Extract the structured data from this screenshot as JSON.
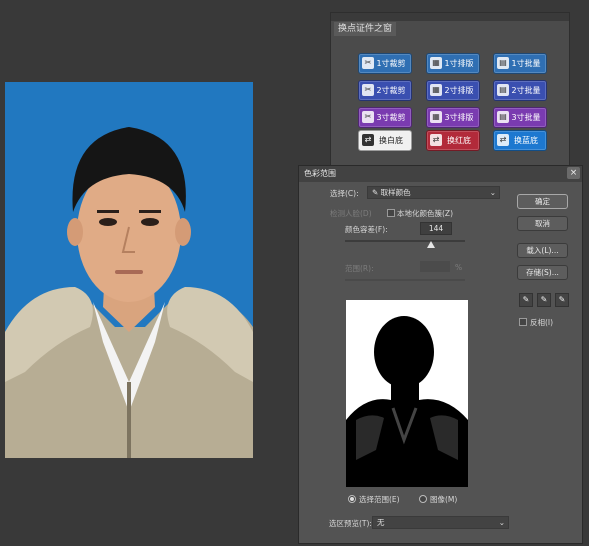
{
  "plugin": {
    "tab_label": "换点证件之窗",
    "buttons": [
      {
        "label": "1寸裁剪",
        "color": "#2f6fb3",
        "icon": "scissors-icon"
      },
      {
        "label": "1寸排版",
        "color": "#2f6fb3",
        "icon": "layout-icon"
      },
      {
        "label": "1寸批量",
        "color": "#2f6fb3",
        "icon": "batch-icon"
      },
      {
        "label": "2寸裁剪",
        "color": "#3a4fb0",
        "icon": "scissors-icon"
      },
      {
        "label": "2寸排版",
        "color": "#3a4fb0",
        "icon": "layout-icon"
      },
      {
        "label": "2寸批量",
        "color": "#3a4fb0",
        "icon": "batch-icon"
      },
      {
        "label": "3寸裁剪",
        "color": "#7a3bb0",
        "icon": "scissors-icon"
      },
      {
        "label": "3寸排版",
        "color": "#7a3bb0",
        "icon": "layout-icon"
      },
      {
        "label": "3寸批量",
        "color": "#7a3bb0",
        "icon": "batch-icon"
      },
      {
        "label": "换白底",
        "color": "#f0f0f0",
        "icon": "swap-icon"
      },
      {
        "label": "换红底",
        "color": "#b22a3a",
        "icon": "swap-icon"
      },
      {
        "label": "换蓝底",
        "color": "#1d78d0",
        "icon": "swap-icon"
      }
    ]
  },
  "dialog": {
    "title": "色彩范围",
    "select_label": "选择(C):",
    "select_value": "取样颜色",
    "detect_faces_label": "检测人脸(D)",
    "localized_label": "本地化颜色簇(Z)",
    "fuzziness_label": "颜色容差(F):",
    "fuzziness_value": "144",
    "fuzziness_level": 0.72,
    "range_label": "范围(R):",
    "range_unit": "%",
    "selection_label": "选择范围(E)",
    "image_label": "图像(M)",
    "selection_preview_label": "选区预览(T):",
    "selection_preview_value": "无",
    "ok": "确定",
    "cancel": "取消",
    "load": "载入(L)...",
    "save": "存储(S)...",
    "invert": "反相(I)",
    "close_glyph": "×"
  },
  "colors": {
    "background": "#393939",
    "photo_blue": "#2178c0",
    "dialog_bg": "#535353"
  }
}
